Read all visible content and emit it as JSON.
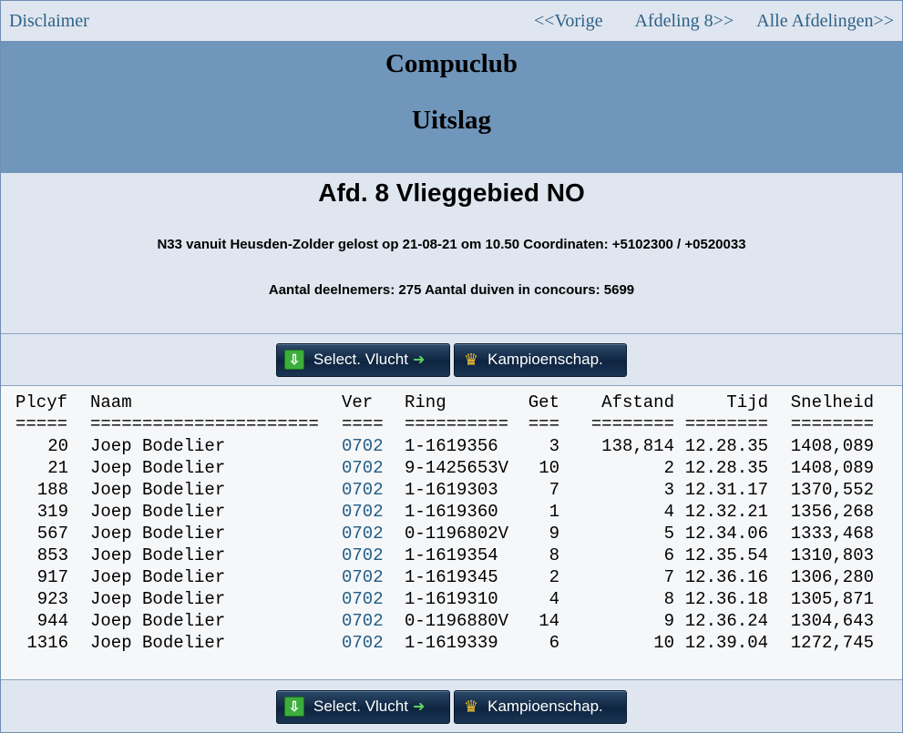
{
  "nav": {
    "disclaimer": "Disclaimer",
    "prev": "<<Vorige",
    "afdeling": "Afdeling 8>>",
    "all": "Alle Afdelingen>>"
  },
  "header": {
    "club": "Compuclub",
    "title": "Uitslag"
  },
  "info": {
    "afdeling": "Afd. 8 Vlieggebied NO",
    "line1": "N33 vanuit Heusden-Zolder gelost op 21-08-21 om 10.50 Coordinaten: +5102300 / +0520033",
    "line2": "Aantal deelnemers: 275 Aantal duiven in concours: 5699"
  },
  "buttons": {
    "select": "Select. Vlucht",
    "kamp": "Kampioenschap."
  },
  "table": {
    "headers": [
      "Plcyf",
      "Naam",
      "Ver",
      "Ring",
      "Get",
      "Afstand",
      "Tijd",
      "Snelheid"
    ],
    "separators": [
      "=====",
      "======================",
      "====",
      "==========",
      "===",
      "========",
      "========",
      "========"
    ],
    "rows": [
      {
        "plc": "20",
        "naam": "Joep Bodelier",
        "ver": "0702",
        "ring": "1-1619356",
        "get": "3",
        "afstand": "138,814",
        "tijd": "12.28.35",
        "snel": "1408,089"
      },
      {
        "plc": "21",
        "naam": "Joep Bodelier",
        "ver": "0702",
        "ring": "9-1425653V",
        "get": "10",
        "afstand": "2",
        "tijd": "12.28.35",
        "snel": "1408,089"
      },
      {
        "plc": "188",
        "naam": "Joep Bodelier",
        "ver": "0702",
        "ring": "1-1619303",
        "get": "7",
        "afstand": "3",
        "tijd": "12.31.17",
        "snel": "1370,552"
      },
      {
        "plc": "319",
        "naam": "Joep Bodelier",
        "ver": "0702",
        "ring": "1-1619360",
        "get": "1",
        "afstand": "4",
        "tijd": "12.32.21",
        "snel": "1356,268"
      },
      {
        "plc": "567",
        "naam": "Joep Bodelier",
        "ver": "0702",
        "ring": "0-1196802V",
        "get": "9",
        "afstand": "5",
        "tijd": "12.34.06",
        "snel": "1333,468"
      },
      {
        "plc": "853",
        "naam": "Joep Bodelier",
        "ver": "0702",
        "ring": "1-1619354",
        "get": "8",
        "afstand": "6",
        "tijd": "12.35.54",
        "snel": "1310,803"
      },
      {
        "plc": "917",
        "naam": "Joep Bodelier",
        "ver": "0702",
        "ring": "1-1619345",
        "get": "2",
        "afstand": "7",
        "tijd": "12.36.16",
        "snel": "1306,280"
      },
      {
        "plc": "923",
        "naam": "Joep Bodelier",
        "ver": "0702",
        "ring": "1-1619310",
        "get": "4",
        "afstand": "8",
        "tijd": "12.36.18",
        "snel": "1305,871"
      },
      {
        "plc": "944",
        "naam": "Joep Bodelier",
        "ver": "0702",
        "ring": "0-1196880V",
        "get": "14",
        "afstand": "9",
        "tijd": "12.36.24",
        "snel": "1304,643"
      },
      {
        "plc": "1316",
        "naam": "Joep Bodelier",
        "ver": "0702",
        "ring": "1-1619339",
        "get": "6",
        "afstand": "10",
        "tijd": "12.39.04",
        "snel": "1272,745"
      }
    ]
  },
  "colors": {
    "nav_link": "#2f6187",
    "header_bg": "#7096bb",
    "page_bg": "#dfe6ef",
    "ver_link": "#1f5c85"
  }
}
